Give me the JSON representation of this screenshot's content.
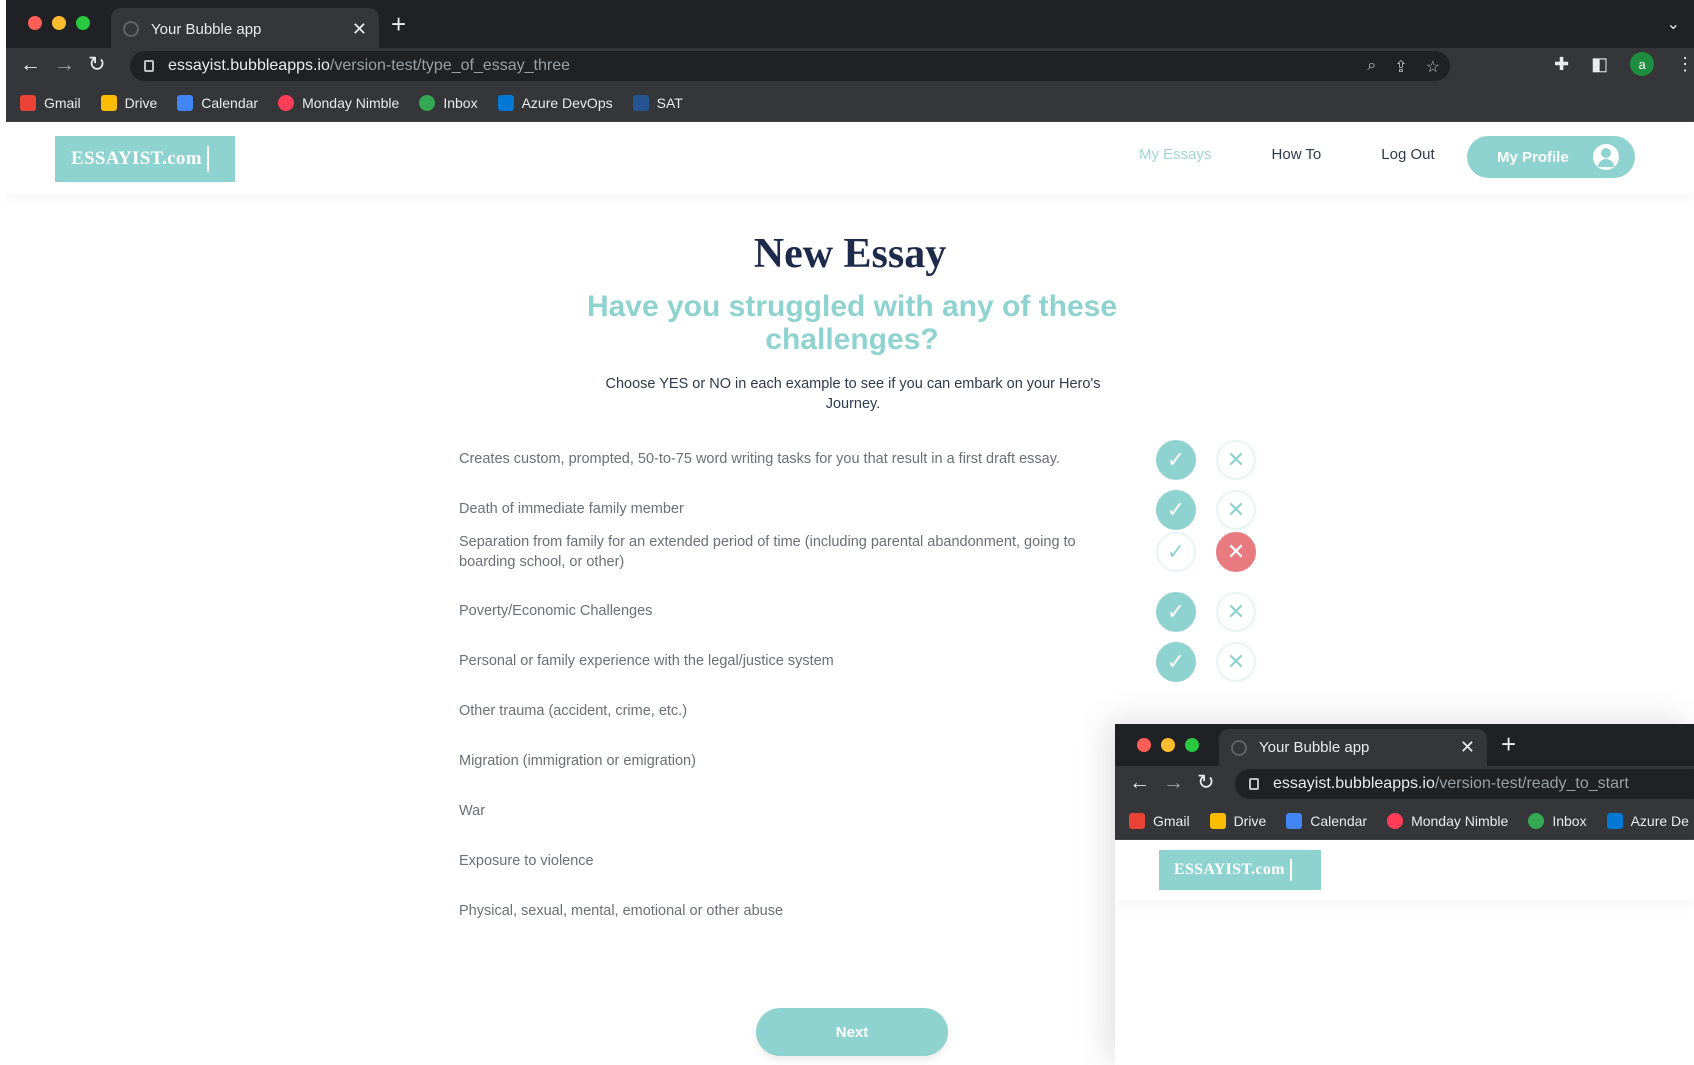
{
  "browser": {
    "tab_title": "Your Bubble app",
    "tab_close": "✕",
    "new_tab": "+",
    "url_host": "essayist.bubbleapps.io",
    "url_path": "/version-test/type_of_essay_three",
    "avatar_letter": "a",
    "bookmarks": [
      {
        "label": "Gmail",
        "color": "#ea4335"
      },
      {
        "label": "Drive",
        "color": "#fbbc04"
      },
      {
        "label": "Calendar",
        "color": "#4285f4"
      },
      {
        "label": "Monday Nimble",
        "color": "#ff3d57"
      },
      {
        "label": "Inbox",
        "color": "#34a853"
      },
      {
        "label": "Azure DevOps",
        "color": "#0078d4"
      },
      {
        "label": "SAT",
        "color": "#1a73e8"
      }
    ]
  },
  "site": {
    "logo": "ESSAYIST.com",
    "nav": {
      "my_essays": "My Essays",
      "how_to": "How To",
      "log_out": "Log Out"
    },
    "profile_button": "My Profile",
    "accent": "#8fd3d1",
    "no_accent": "#e97a7f"
  },
  "main": {
    "title": "New Essay",
    "subtitle": "Have you struggled with any of these challenges?",
    "instructions": "Choose YES or NO in each example to see if you can embark on your Hero's Journey.",
    "questions": [
      {
        "text": "Creates custom, prompted, 50-to-75 word writing tasks for you that result in a first draft essay.",
        "answer": "yes"
      },
      {
        "text": "Death of immediate family member",
        "answer": "yes"
      },
      {
        "text": "Separation from family for an extended period of time (including parental abandonment, going to boarding school, or other)",
        "answer": "no"
      },
      {
        "text": "Poverty/Economic Challenges",
        "answer": "yes"
      },
      {
        "text": "Personal or family experience with the legal/justice system",
        "answer": "yes"
      },
      {
        "text": "Other trauma (accident, crime, etc.)",
        "answer": "hidden"
      },
      {
        "text": "Migration (immigration or emigration)",
        "answer": "hidden"
      },
      {
        "text": "War",
        "answer": "hidden"
      },
      {
        "text": "Exposure to violence",
        "answer": "hidden"
      },
      {
        "text": "Physical, sexual, mental, emotional or other abuse",
        "answer": "hidden"
      }
    ],
    "check_glyph": "✓",
    "cross_glyph": "✕",
    "next_button": "Next"
  },
  "overlay_window": {
    "tab_title": "Your Bubble app",
    "url_host": "essayist.bubbleapps.io",
    "url_path": "/version-test/ready_to_start",
    "bookmarks": [
      "Gmail",
      "Drive",
      "Calendar",
      "Monday Nimble",
      "Inbox",
      "Azure De"
    ],
    "logo": "ESSAYIST.com"
  }
}
